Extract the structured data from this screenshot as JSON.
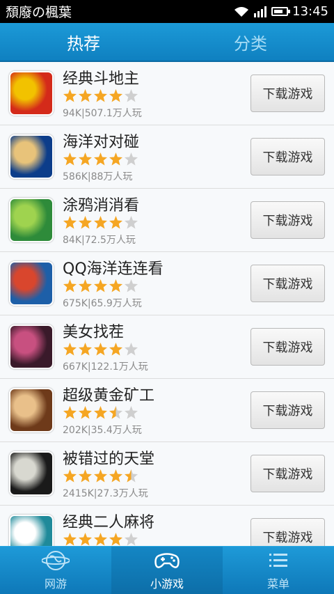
{
  "status": {
    "title": "頹廢の楓葉",
    "time": "13:45"
  },
  "tabs": [
    {
      "label": "热荐"
    },
    {
      "label": "分类"
    }
  ],
  "games": [
    {
      "name": "经典斗地主",
      "meta": "94K|507.1万人玩",
      "rating": 4,
      "button": "下载游戏",
      "icon": "doudizhu-icon",
      "c1": "#d42a1a",
      "c2": "#f2c200"
    },
    {
      "name": "海洋对对碰",
      "meta": "586K|88万人玩",
      "rating": 4,
      "button": "下载游戏",
      "icon": "ocean-match-icon",
      "c1": "#0c3d8a",
      "c2": "#e8c37a"
    },
    {
      "name": "涂鸦消消看",
      "meta": "84K|72.5万人玩",
      "rating": 4,
      "button": "下载游戏",
      "icon": "doodle-icon",
      "c1": "#2e8b3a",
      "c2": "#9fd34f"
    },
    {
      "name": "QQ海洋连连看",
      "meta": "675K|65.9万人玩",
      "rating": 4,
      "button": "下载游戏",
      "icon": "penguin-icon",
      "c1": "#1d5fa8",
      "c2": "#d9462d"
    },
    {
      "name": "美女找茬",
      "meta": "667K|122.1万人玩",
      "rating": 4,
      "button": "下载游戏",
      "icon": "beauty-icon",
      "c1": "#3a1a2a",
      "c2": "#c85080"
    },
    {
      "name": "超级黄金矿工",
      "meta": "202K|35.4万人玩",
      "rating": 3.5,
      "button": "下载游戏",
      "icon": "gold-miner-icon",
      "c1": "#6e3a1a",
      "c2": "#e9c08a"
    },
    {
      "name": "被错过的天堂",
      "meta": "2415K|27.3万人玩",
      "rating": 4.5,
      "button": "下载游戏",
      "icon": "heaven-icon",
      "c1": "#1a1a1a",
      "c2": "#d8d8d0"
    },
    {
      "name": "经典二人麻将",
      "meta": "",
      "rating": 4,
      "button": "下载游戏",
      "icon": "mahjong-icon",
      "c1": "#1f8a9a",
      "c2": "#ffffff"
    }
  ],
  "bottom_nav": [
    {
      "label": "网游",
      "icon": "globe-icon"
    },
    {
      "label": "小游戏",
      "icon": "gamepad-icon"
    },
    {
      "label": "菜单",
      "icon": "menu-icon"
    }
  ],
  "colors": {
    "star": "#f5a623",
    "star_empty": "#cfcfcf",
    "accent": "#1a8fd0"
  }
}
